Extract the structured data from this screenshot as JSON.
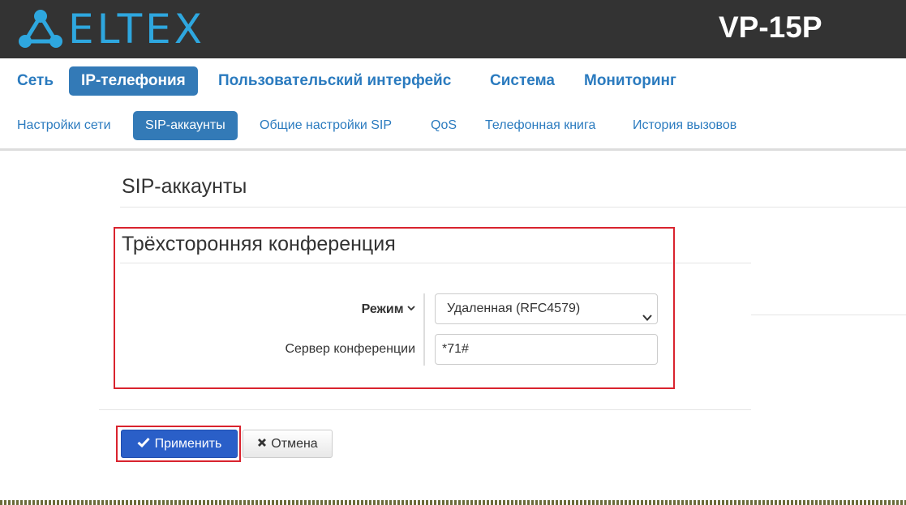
{
  "header": {
    "logo_text": "ELTEX",
    "model": "VP-15P",
    "accent_color": "#2ea7df"
  },
  "main_nav": {
    "items": [
      {
        "label": "Сеть",
        "active": false
      },
      {
        "label": "IP-телефония",
        "active": true
      },
      {
        "label": "Пользовательский интерфейс",
        "active": false
      },
      {
        "label": "Система",
        "active": false
      },
      {
        "label": "Мониторинг",
        "active": false
      }
    ]
  },
  "sub_nav": {
    "items": [
      {
        "label": "Настройки сети",
        "active": false
      },
      {
        "label": "SIP-аккаунты",
        "active": true
      },
      {
        "label": "Общие настройки SIP",
        "active": false
      },
      {
        "label": "QoS",
        "active": false
      },
      {
        "label": "Телефонная книга",
        "active": false
      },
      {
        "label": "История вызовов",
        "active": false
      }
    ]
  },
  "page": {
    "title": "SIP-аккаунты",
    "section_title": "Трёхсторонняя конференция"
  },
  "form": {
    "mode_label": "Режим",
    "mode_value": "Удаленная (RFC4579)",
    "server_label": "Сервер конференции",
    "server_value": "*71#"
  },
  "buttons": {
    "apply_label": "Применить",
    "cancel_label": "Отмена"
  },
  "colors": {
    "link": "#2b7bbf",
    "active_tab": "#337ab7",
    "highlight": "#d9232e",
    "apply_button": "#2a5fc8"
  },
  "icons": {
    "logo": "eltex-network-icon",
    "mode_toggle": "chevron-down-icon",
    "select_caret": "chevron-down-icon",
    "apply": "check-icon",
    "cancel": "close-icon"
  }
}
